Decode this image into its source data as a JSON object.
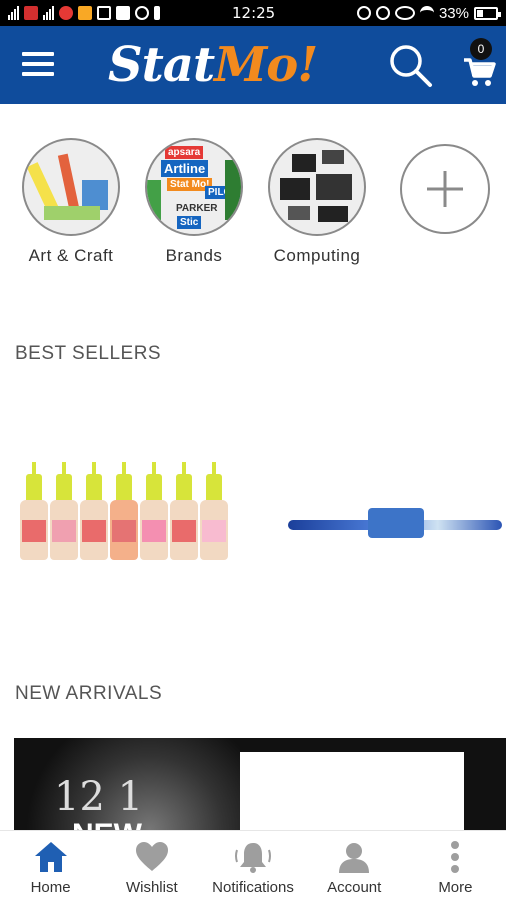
{
  "status_bar": {
    "time": "12:25",
    "battery": "33%",
    "battery_level": 0.33
  },
  "app_bar": {
    "logo_part1": "Stat",
    "logo_part2": "Mo!",
    "cart_count": "0",
    "colors": {
      "bar": "#0f4c9c",
      "logo_accent": "#f28a1e"
    },
    "icons": [
      "menu-icon",
      "search-icon",
      "cart-icon"
    ]
  },
  "categories": [
    {
      "label": "Art & Craft"
    },
    {
      "label": "Brands"
    },
    {
      "label": "Computing"
    },
    {
      "label": ""
    }
  ],
  "brand_thumb_words": [
    "apsara",
    "Artline",
    "Stat Mo!",
    "PILOT",
    "PARKER",
    "Stic"
  ],
  "sections": {
    "best_sellers": "BEST SELLERS",
    "new_arrivals": "NEW ARRIVALS"
  },
  "new_arrivals_banner": {
    "clock_digits": "12  1",
    "text": "NEW"
  },
  "bottom_nav": [
    {
      "label": "Home",
      "icon": "home-icon",
      "active": true
    },
    {
      "label": "Wishlist",
      "icon": "heart-icon",
      "active": false
    },
    {
      "label": "Notifications",
      "icon": "bell-icon",
      "active": false
    },
    {
      "label": "Account",
      "icon": "account-icon",
      "active": false
    },
    {
      "label": "More",
      "icon": "more-vertical-icon",
      "active": false
    }
  ]
}
